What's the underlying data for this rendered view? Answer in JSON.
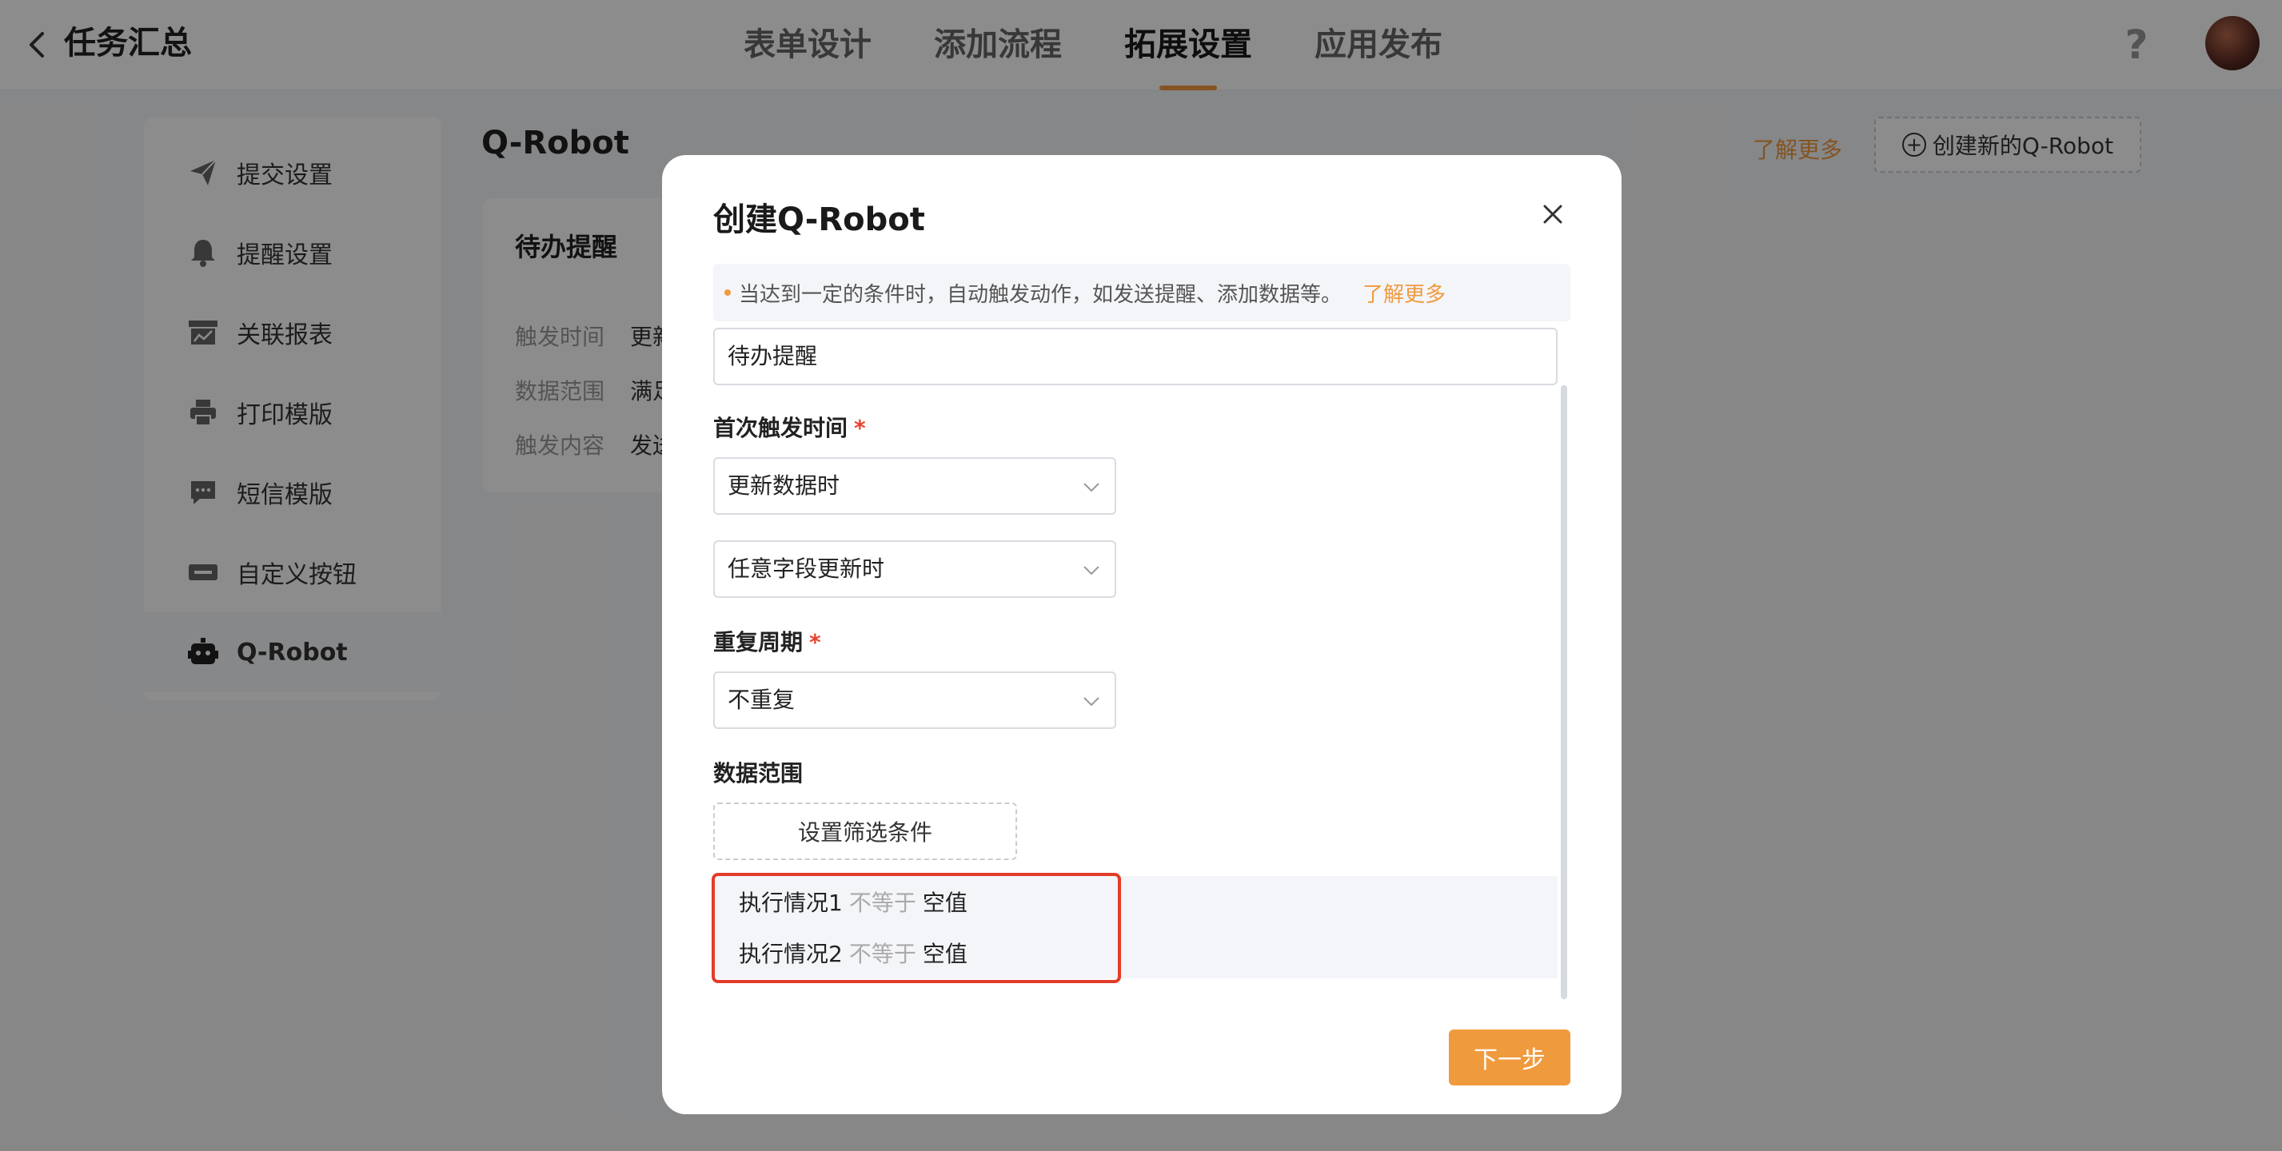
{
  "header": {
    "title": "任务汇总",
    "tabs": [
      {
        "label": "表单设计"
      },
      {
        "label": "添加流程"
      },
      {
        "label": "拓展设置"
      },
      {
        "label": "应用发布"
      }
    ],
    "active_tab": "拓展设置",
    "help_icon": "?"
  },
  "sidebar": {
    "items": [
      {
        "label": "提交设置",
        "icon": "send-icon"
      },
      {
        "label": "提醒设置",
        "icon": "bell-icon"
      },
      {
        "label": "关联报表",
        "icon": "report-icon"
      },
      {
        "label": "打印模版",
        "icon": "printer-icon"
      },
      {
        "label": "短信模版",
        "icon": "message-icon"
      },
      {
        "label": "自定义按钮",
        "icon": "custom-button-icon"
      },
      {
        "label": "Q-Robot",
        "icon": "robot-icon"
      }
    ],
    "active_item": "Q-Robot"
  },
  "main": {
    "title": "Q-Robot",
    "learn_more": "了解更多",
    "create_button": "创建新的Q-Robot",
    "card": {
      "title": "待办提醒",
      "rows": [
        {
          "key": "触发时间",
          "value": "更新"
        },
        {
          "key": "数据范围",
          "value": "满足"
        },
        {
          "key": "触发内容",
          "value": "发送"
        }
      ]
    }
  },
  "modal": {
    "title": "创建Q-Robot",
    "tip_text": "当达到一定的条件时，自动触发动作，如发送提醒、添加数据等。",
    "tip_link": "了解更多",
    "name_value": "待办提醒",
    "first_trigger_label": "首次触发时间",
    "first_trigger_value": "更新数据时",
    "field_trigger_value": "任意字段更新时",
    "repeat_label": "重复周期",
    "repeat_value": "不重复",
    "required_mark": "*",
    "data_range_label": "数据范围",
    "filter_button": "设置筛选条件",
    "conditions": [
      {
        "field": "执行情况1",
        "op": "不等于",
        "value": "空值"
      },
      {
        "field": "执行情况2",
        "op": "不等于",
        "value": "空值"
      }
    ],
    "next_button": "下一步"
  },
  "colors": {
    "accent": "#f09a3e",
    "required": "#e9432d",
    "highlight": "#e33b2a"
  }
}
